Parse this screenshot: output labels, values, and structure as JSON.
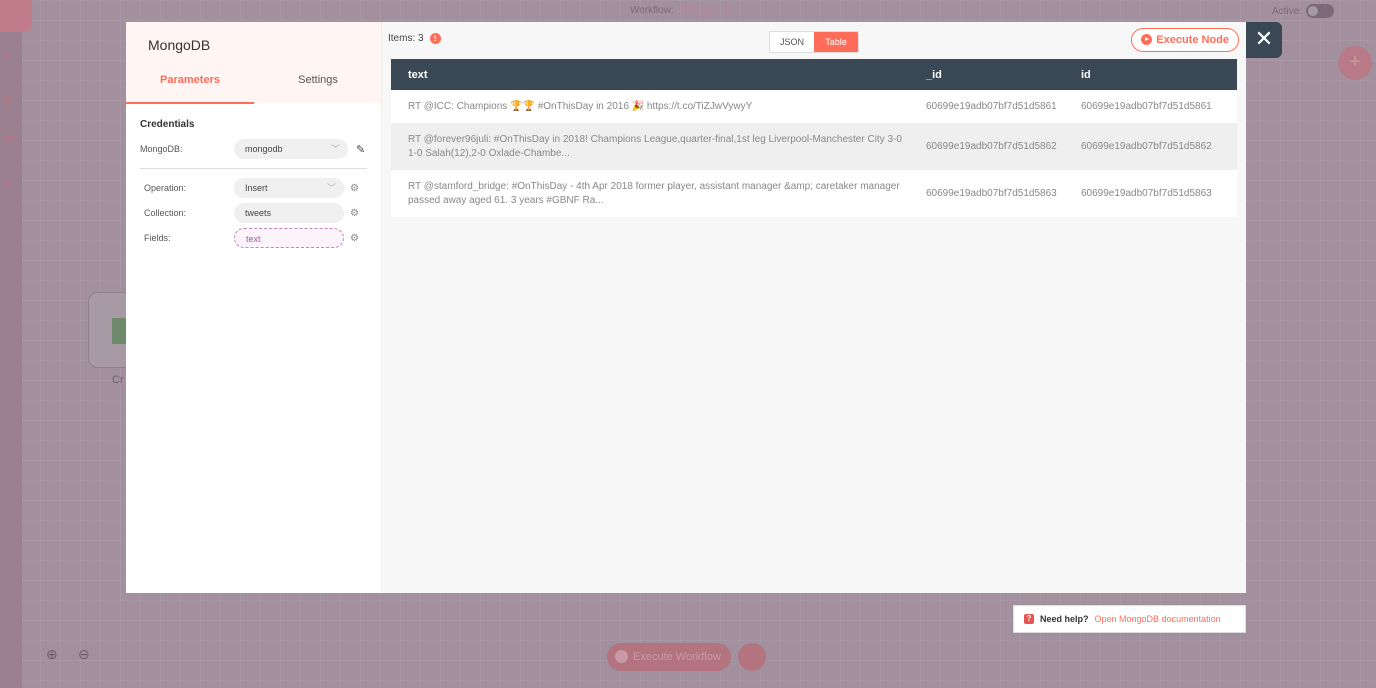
{
  "background": {
    "workflow_label": "Workflow:",
    "workflow_name": "ETL pipeline",
    "active_label": "Active:",
    "node_label": "Cr",
    "execute_workflow": "Execute Workflow"
  },
  "node_panel": {
    "title": "MongoDB",
    "tabs": [
      "Parameters",
      "Settings"
    ],
    "credentials_heading": "Credentials",
    "credential": {
      "label": "MongoDB:",
      "value": "mongodb"
    },
    "operation": {
      "label": "Operation:",
      "value": "Insert"
    },
    "collection": {
      "label": "Collection:",
      "value": "tweets"
    },
    "fields": {
      "label": "Fields:",
      "value": "text"
    }
  },
  "output": {
    "items_label": "Items: 3",
    "modes": [
      "JSON",
      "Table"
    ],
    "active_mode": "Table",
    "execute_node": "Execute Node",
    "columns": [
      "text",
      "_id",
      "id"
    ],
    "rows": [
      {
        "text": "RT @ICC: Champions 🏆🏆 #OnThisDay in 2016 🎉 https://t.co/TiZJwVywyY",
        "_id": "60699e19adb07bf7d51d5861",
        "id": "60699e19adb07bf7d51d5861"
      },
      {
        "text": "RT @forever96juli: #OnThisDay in 2018! Champions League,quarter-final,1st leg Liverpool-Manchester City 3-0 1-0 Salah(12),2-0 Oxlade-Chambe...",
        "_id": "60699e19adb07bf7d51d5862",
        "id": "60699e19adb07bf7d51d5862"
      },
      {
        "text": "RT @stamford_bridge: #OnThisDay - 4th Apr 2018 former player, assistant manager &amp; caretaker manager passed away aged 61. 3 years #GBNF Ra...",
        "_id": "60699e19adb07bf7d51d5863",
        "id": "60699e19adb07bf7d51d5863"
      }
    ]
  },
  "help": {
    "question": "Need help?",
    "link": "Open MongoDB documentation"
  },
  "colors": {
    "accent": "#ff6d5a",
    "header": "#3a4754"
  }
}
